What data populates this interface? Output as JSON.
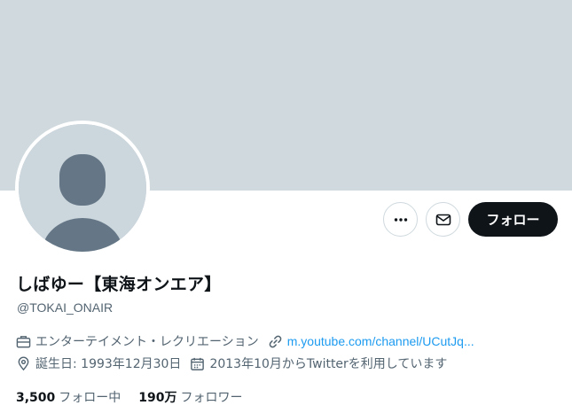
{
  "profile": {
    "display_name": "しばゆー【東海オンエア】",
    "handle": "@TOKAI_ONAIR",
    "category": "エンターテイメント・レクリエーション",
    "website": "m.youtube.com/channel/UCutJq...",
    "birthday": "誕生日: 1993年12月30日",
    "joined": "2013年10月からTwitterを利用しています"
  },
  "actions": {
    "follow_label": "フォロー",
    "more_icon": "more-icon",
    "message_icon": "envelope-icon"
  },
  "stats": {
    "following_count": "3,500",
    "following_label": "フォロー中",
    "followers_count": "190万",
    "followers_label": "フォロワー"
  },
  "colors": {
    "banner": "#cfd9de",
    "link": "#1d9bf0",
    "follow_button": "#0f1419",
    "muted_text": "#536471"
  }
}
